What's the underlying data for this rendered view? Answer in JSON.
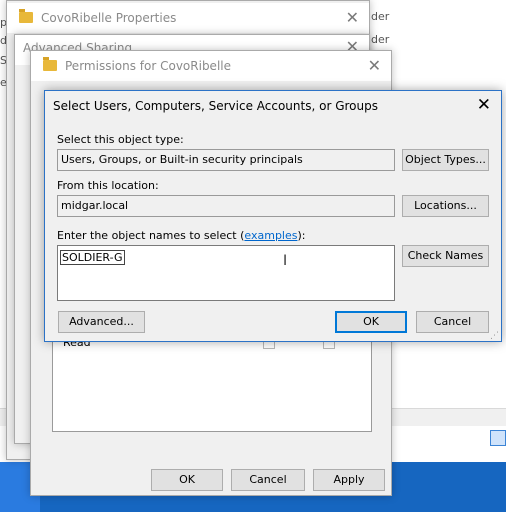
{
  "background": {
    "side_fragments": [
      "lder",
      "lder",
      "p",
      "di",
      "Sa",
      "e"
    ],
    "top_fragment": "..."
  },
  "win_props": {
    "title": "CovoRibelle Properties",
    "close": "✕"
  },
  "win_adv": {
    "title": "Advanced Sharing",
    "close": "✕"
  },
  "win_perm": {
    "title": "Permissions for CovoRibelle",
    "close": "✕",
    "perm_row_label": "Read",
    "ok": "OK",
    "cancel": "Cancel",
    "apply": "Apply"
  },
  "dialog": {
    "title": "Select Users, Computers, Service Accounts, or Groups",
    "close": "✕",
    "object_type_label": "Select this object type:",
    "object_type_value": "Users, Groups, or Built-in security principals",
    "object_types_btn": "Object Types...",
    "location_label": "From this location:",
    "location_value": "midgar.local",
    "locations_btn": "Locations...",
    "names_label_prefix": "Enter the object names to select (",
    "names_label_link": "examples",
    "names_label_suffix": "):",
    "names_value": "SOLDIER-G",
    "check_names_btn": "Check Names",
    "advanced_btn": "Advanced...",
    "ok_btn": "OK",
    "cancel_btn": "Cancel"
  },
  "colors": {
    "accent": "#0078d7",
    "taskbar": "#1666c0",
    "folder": "#e8b83a"
  }
}
